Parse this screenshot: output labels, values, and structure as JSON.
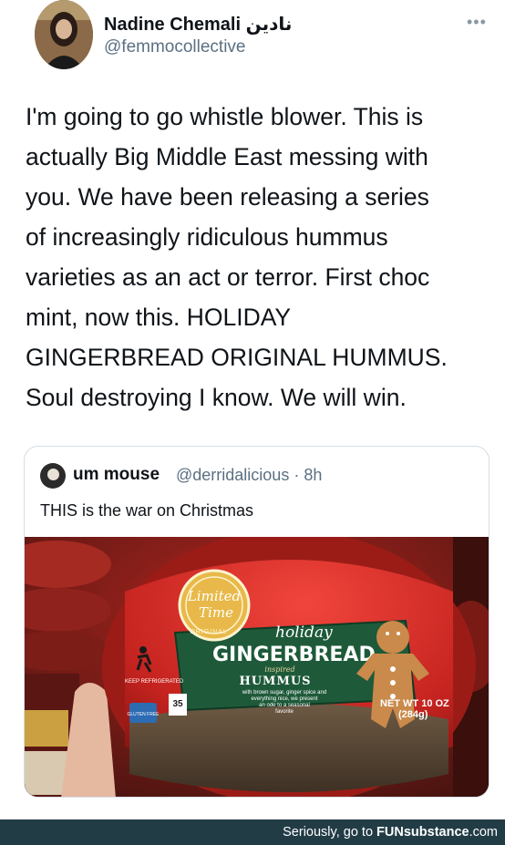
{
  "tweet": {
    "display_name": "Nadine Chemali نادين",
    "handle": "@femmocollective",
    "more_icon": "more-horizontal-icon",
    "body_lines": [
      "I'm going to go whistle blower. This is",
      "actually Big Middle East messing with",
      "you. We have been releasing a series",
      "of increasingly ridiculous hummus",
      "varieties as an act or terror. First choc",
      "mint, now this. HOLIDAY",
      "GINGERBREAD ORIGINAL HUMMUS.",
      "Soul destroying I know. We will win."
    ]
  },
  "quote": {
    "display_name": "um mouse",
    "handle_time": "@derridalicious · 8h",
    "text": "THIS is the war on Christmas",
    "image": {
      "badge_line1": "Limited",
      "badge_line2": "Time",
      "badge_arc": "ORIGINAL",
      "label_small": "holiday",
      "label_main": "GINGERBREAD",
      "label_inspired": "inspired",
      "label_hummus": "HUMMUS",
      "label_desc_1": "with brown sugar, ginger spice and",
      "label_desc_2": "everything nice, we present",
      "label_desc_3": "an ode to a seasonal",
      "label_desc_4": "favorite",
      "keep_refrigerated": "KEEP REFRIGERATED",
      "calories": "35",
      "gluten_free": "GLUTEN FREE",
      "net_wt_1": "NET WT 10 OZ",
      "net_wt_2": "(284g)"
    }
  },
  "footer": {
    "prefix": "Seriously, go to ",
    "brand": "FUNsubstance",
    "suffix": ".com"
  },
  "colors": {
    "handle_gray": "#5b7083",
    "footer_bg": "#223c46",
    "lid_red": "#c5231f",
    "label_green": "#1e5a3a",
    "badge_gold": "#e8b94a"
  }
}
